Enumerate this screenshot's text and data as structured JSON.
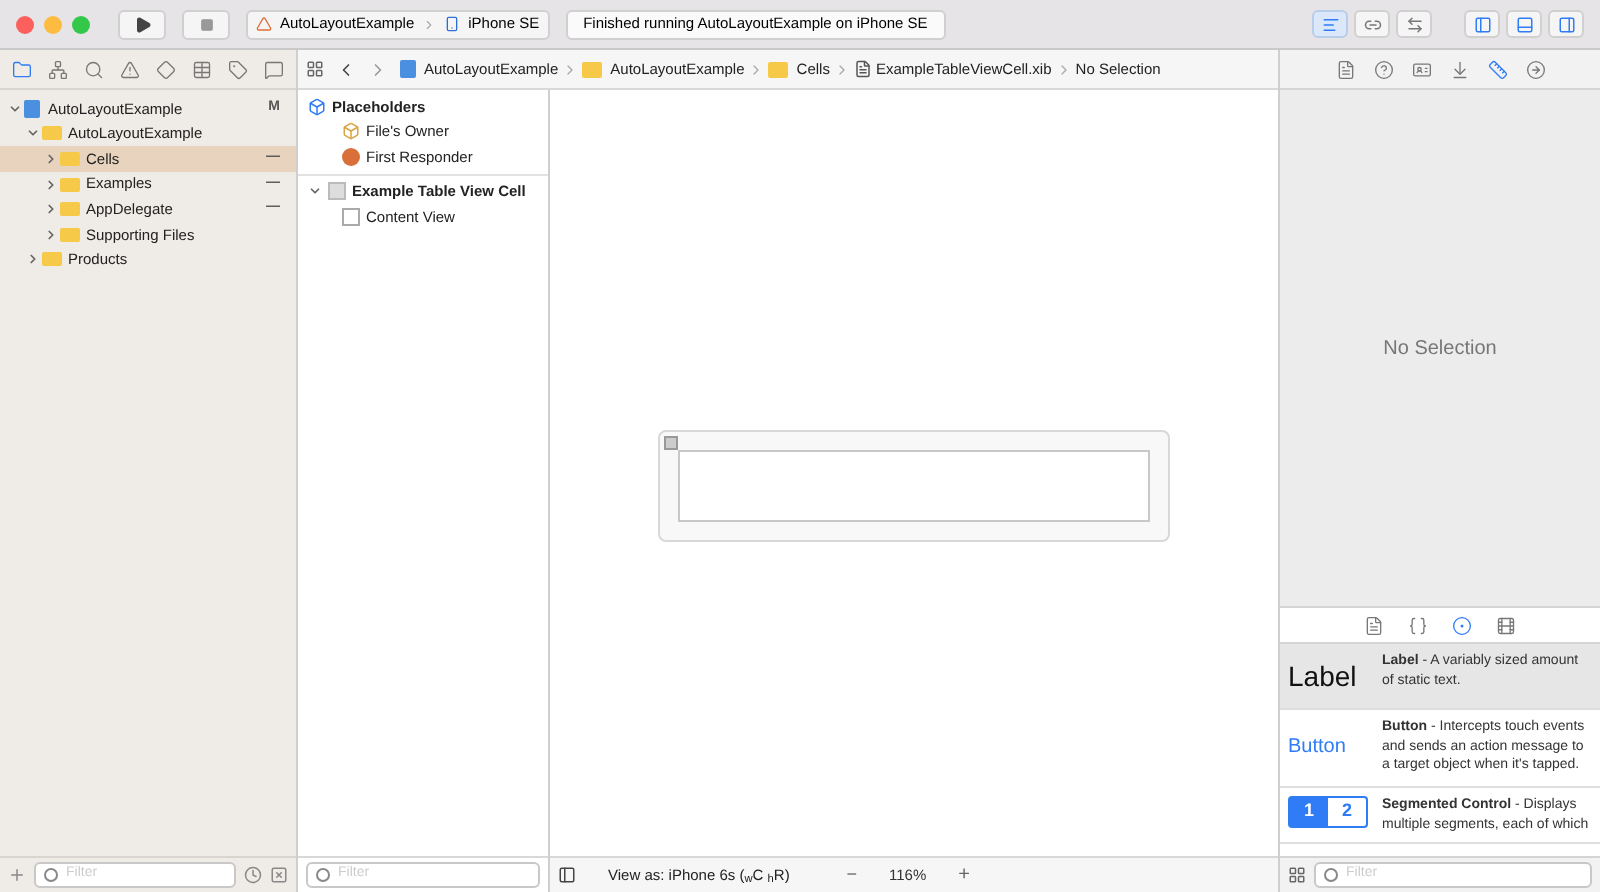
{
  "toolbar": {
    "scheme": "AutoLayoutExample",
    "device": "iPhone SE",
    "status": "Finished running AutoLayoutExample on iPhone SE",
    "editors": [
      {
        "kind": "standard",
        "selected": true
      },
      {
        "kind": "assistant",
        "selected": false
      },
      {
        "kind": "version",
        "selected": false
      }
    ],
    "panels": [
      {
        "kind": "left",
        "on": true
      },
      {
        "kind": "bottom",
        "on": true
      },
      {
        "kind": "right",
        "on": true
      }
    ]
  },
  "navigator": {
    "tabs": [
      {
        "kind": "folder",
        "selected": true
      },
      {
        "kind": "hierarchy",
        "selected": false
      },
      {
        "kind": "search",
        "selected": false
      },
      {
        "kind": "warning",
        "selected": false
      },
      {
        "kind": "diamond",
        "selected": false
      },
      {
        "kind": "table",
        "selected": false
      },
      {
        "kind": "tag",
        "selected": false
      },
      {
        "kind": "speech",
        "selected": false
      }
    ],
    "tree": [
      {
        "label": "AutoLayoutExample",
        "kind": "project",
        "status": "M",
        "expanded": true,
        "selected": false,
        "children": [
          {
            "label": "AutoLayoutExample",
            "kind": "folder",
            "expanded": true,
            "selected": false,
            "children": [
              {
                "label": "Cells",
                "kind": "folder",
                "status": "—",
                "expanded": false,
                "selected": true
              },
              {
                "label": "Examples",
                "kind": "folder",
                "status": "—",
                "expanded": false,
                "selected": false
              },
              {
                "label": "AppDelegate",
                "kind": "folder",
                "status": "—",
                "expanded": false,
                "selected": false
              },
              {
                "label": "Supporting Files",
                "kind": "folder",
                "expanded": false,
                "selected": false
              }
            ]
          },
          {
            "label": "Products",
            "kind": "folder",
            "expanded": false,
            "selected": false
          }
        ]
      }
    ],
    "filter": {
      "placeholder": "Filter"
    }
  },
  "jumpbar": [
    {
      "label": "AutoLayoutExample",
      "kind": "project"
    },
    {
      "label": "AutoLayoutExample",
      "kind": "folder"
    },
    {
      "label": "Cells",
      "kind": "folder"
    },
    {
      "label": "ExampleTableViewCell.xib",
      "kind": "file"
    },
    {
      "label": "No Selection",
      "kind": "none"
    }
  ],
  "outline": {
    "sections": [
      {
        "title": "Placeholders",
        "kind": "placeholders",
        "items": [
          {
            "label": "File's Owner",
            "kind": "owner"
          },
          {
            "label": "First Responder",
            "kind": "responder"
          }
        ]
      },
      {
        "title": "Example Table View Cell",
        "kind": "cell",
        "expanded": true,
        "items": [
          {
            "label": "Content View",
            "kind": "view"
          }
        ]
      }
    ],
    "filter": {
      "placeholder": "Filter"
    }
  },
  "canvas": {
    "view_as": "View as: iPhone 6s ($_{w}$C $_{h}$R)",
    "zoom_out": "−",
    "zoom": "116%",
    "zoom_in": "+"
  },
  "inspector": {
    "tabs": [
      {
        "kind": "file",
        "selected": false
      },
      {
        "kind": "help",
        "selected": false
      },
      {
        "kind": "identity",
        "selected": false
      },
      {
        "kind": "attributes",
        "selected": false
      },
      {
        "kind": "size",
        "selected": true
      },
      {
        "kind": "connections",
        "selected": false
      }
    ],
    "message": "No Selection"
  },
  "library": {
    "tabs": [
      {
        "kind": "file",
        "selected": false
      },
      {
        "kind": "code",
        "selected": false
      },
      {
        "kind": "object",
        "selected": true
      },
      {
        "kind": "media",
        "selected": false
      }
    ],
    "items": [
      {
        "kind": "label",
        "preview": "Label",
        "text": "**Label** - A variably sized amount of static text.",
        "selected": true
      },
      {
        "kind": "button",
        "preview": "Button",
        "text": "**Button** - Intercepts touch events and sends an action message to a target object when it's tapped.",
        "selected": false
      },
      {
        "kind": "segmented",
        "preview_segments": [
          "1",
          "2"
        ],
        "text": "**Segmented Control** - Displays multiple segments, each of which",
        "selected": false
      }
    ],
    "filter": {
      "placeholder": "Filter"
    }
  }
}
